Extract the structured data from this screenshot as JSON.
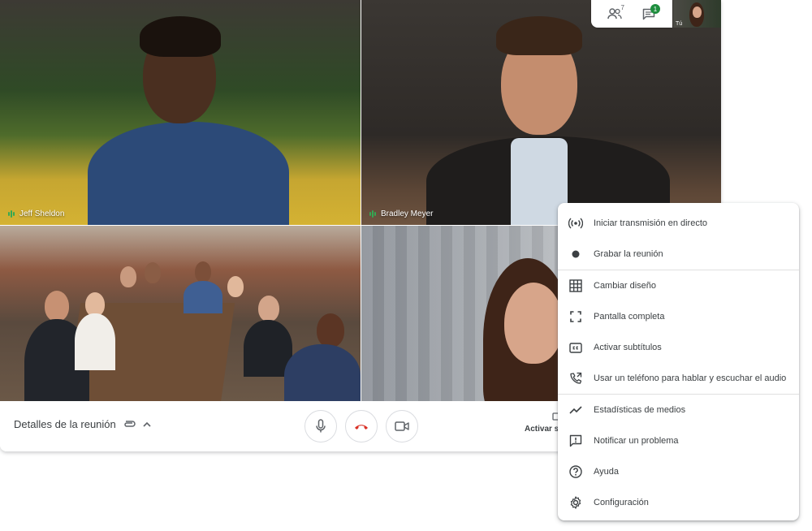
{
  "participants": [
    {
      "name": "Jeff Sheldon"
    },
    {
      "name": "Bradley Meyer"
    }
  ],
  "top_bar": {
    "people_count": "7",
    "chat_badge": "1",
    "self_label": "Tú"
  },
  "bottom_bar": {
    "meeting_details_label": "Detalles de la reunión",
    "captions_label": "Activar s"
  },
  "menu": {
    "items": [
      {
        "label": "Iniciar transmisión en directo",
        "icon": "broadcast-icon"
      },
      {
        "label": "Grabar la reunión",
        "icon": "record-icon"
      },
      {
        "label": "Cambiar diseño",
        "icon": "grid-layout-icon"
      },
      {
        "label": "Pantalla completa",
        "icon": "fullscreen-icon"
      },
      {
        "label": "Activar subtítulos",
        "icon": "closed-captions-icon"
      },
      {
        "label": "Usar un teléfono para hablar y escuchar el audio",
        "icon": "phone-forward-icon"
      },
      {
        "label": "Estadísticas de medios",
        "icon": "trending-icon"
      },
      {
        "label": "Notificar un problema",
        "icon": "feedback-icon"
      },
      {
        "label": "Ayuda",
        "icon": "help-icon"
      },
      {
        "label": "Configuración",
        "icon": "settings-icon"
      }
    ]
  },
  "colors": {
    "end_call": "#d93025",
    "speaking": "#34a853",
    "badge": "#1e8e3e"
  }
}
